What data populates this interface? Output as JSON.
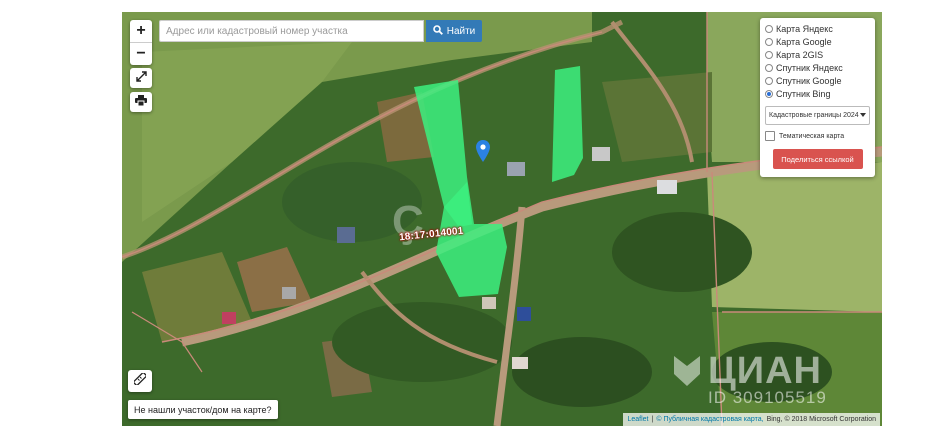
{
  "map": {
    "search_placeholder": "Адрес или кадастровый номер участка",
    "find_label": "Найти",
    "zoom_in": "+",
    "zoom_out": "−",
    "parcel_label": "18:17:014001",
    "not_found_label": "Не нашли участок/дом на карте?",
    "icons": {
      "zoom_in": "plus-icon",
      "zoom_out": "minus-icon",
      "fullscreen": "expand-icon",
      "print": "print-icon",
      "ruler": "ruler-icon",
      "search": "search-icon",
      "marker": "map-pin-icon"
    }
  },
  "layers": {
    "options": [
      {
        "label": "Карта Яндекс",
        "selected": false
      },
      {
        "label": "Карта Google",
        "selected": false
      },
      {
        "label": "Карта 2GIS",
        "selected": false
      },
      {
        "label": "Спутник Яндекс",
        "selected": false
      },
      {
        "label": "Спутник Google",
        "selected": false
      },
      {
        "label": "Спутник Bing",
        "selected": true
      }
    ],
    "boundaries_select": "Кадастровые границы 2024",
    "thematic_label": "Тематическая карта",
    "thematic_checked": false,
    "share_label": "Поделиться ссылкой"
  },
  "attribution": {
    "leaflet": "Leaflet",
    "separator": "|",
    "public_map": "© Публичная кадастровая карта,",
    "bing": "Bing, © 2018 Microsoft Corporation"
  },
  "watermark": {
    "brand": "ЦИАН",
    "listing_id": "ID 309105519",
    "center_mark": "Ҫ"
  },
  "colors": {
    "parcel_fill": "#3cf07f",
    "boundary": "#c98a7a",
    "primary_button": "#337ab7",
    "share_button": "#d9534f",
    "label_outline": "#a30000"
  }
}
